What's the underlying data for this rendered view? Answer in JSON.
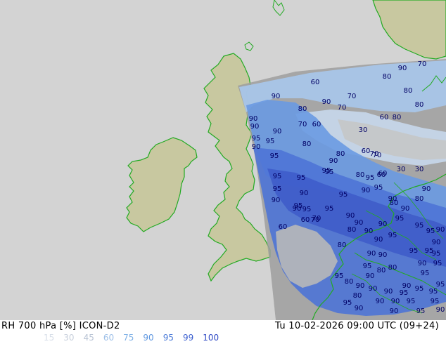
{
  "header": {
    "left": "RH 700 hPa [%] ICON-D2",
    "right": "Tu 10-02-2026 09:00 UTC (09+24)"
  },
  "legend": {
    "values": [
      "15",
      "30",
      "45",
      "60",
      "75",
      "90",
      "95",
      "99",
      "100"
    ],
    "colors": [
      "#d7dee8",
      "#c8d0dc",
      "#b8c3d4",
      "#9ec0e8",
      "#7eb0e6",
      "#5f97e0",
      "#4a7ad8",
      "#3b5fd0",
      "#2f49c4"
    ]
  },
  "map": {
    "colors": {
      "sea": "#d3d3d3",
      "land": "#c8c8a0",
      "coast": "#22aa22",
      "contour_label": "#000066"
    },
    "contour_labels": [
      "90",
      "80",
      "70",
      "60",
      "80",
      "70",
      "90",
      "80",
      "90",
      "80",
      "70",
      "60",
      "80",
      "90",
      "70",
      "60",
      "30",
      "90",
      "95",
      "90",
      "70",
      "60",
      "90",
      "95",
      "80",
      "60",
      "70",
      "95",
      "80",
      "95",
      "90",
      "30",
      "30",
      "95",
      "80",
      "60",
      "95",
      "95",
      "90",
      "95",
      "95",
      "90",
      "90",
      "95",
      "80",
      "90",
      "90",
      "60",
      "70",
      "95",
      "95",
      "90",
      "90",
      "80",
      "95",
      "90",
      "60",
      "70",
      "95",
      "90",
      "90",
      "95",
      "95",
      "90",
      "80",
      "90",
      "95",
      "90",
      "95",
      "80",
      "90",
      "95",
      "95",
      "90",
      "90",
      "95",
      "80",
      "90",
      "95",
      "95",
      "80",
      "90",
      "90",
      "95",
      "95",
      "90",
      "90",
      "95",
      "95",
      "90",
      "80",
      "95",
      "90",
      "90",
      "95",
      "95",
      "95",
      "90",
      "90",
      "95",
      "90",
      "95",
      "80",
      "90"
    ]
  }
}
